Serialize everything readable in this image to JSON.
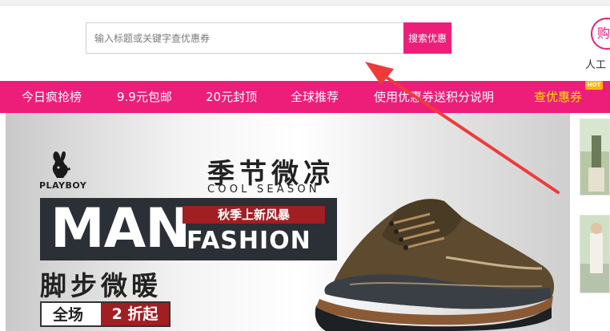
{
  "search": {
    "placeholder": "输入标题或关键字查优惠券",
    "button_label": "搜索优惠"
  },
  "service": {
    "badge_char": "购",
    "label": "人工"
  },
  "nav": {
    "items": [
      {
        "label": "今日疯抢榜"
      },
      {
        "label": "9.9元包邮"
      },
      {
        "label": "20元封顶"
      },
      {
        "label": "全球推荐"
      },
      {
        "label": "使用优惠券送积分说明"
      },
      {
        "label": "查优惠券"
      }
    ],
    "hot_badge": "HOT"
  },
  "banner": {
    "brand": "PLAYBOY",
    "season_title": "季节微凉",
    "season_subtitle": "COOL SEASON",
    "man": "MAN",
    "autumn_tag": "秋季上新风暴",
    "fashion": "FASHION",
    "warm_title": "脚步微暖",
    "promo_left": "全场",
    "promo_right": "2 折起"
  },
  "colors": {
    "brand_pink": "#ec1e79",
    "nav_active": "#ffe600",
    "banner_red": "#a01f23",
    "annotation_arrow": "#f03a3a"
  }
}
